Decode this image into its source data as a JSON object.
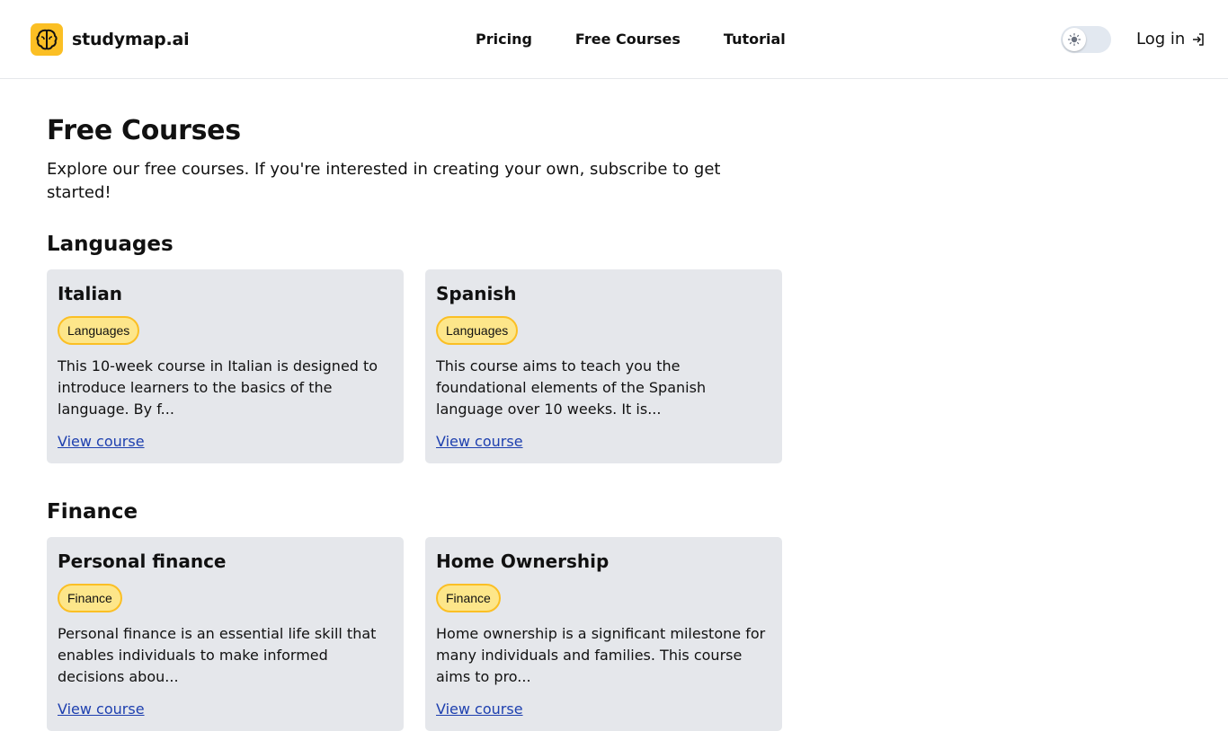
{
  "header": {
    "brand_name": "studymap.ai",
    "logo_icon": "brain-icon",
    "nav": [
      {
        "label": "Pricing"
      },
      {
        "label": "Free Courses"
      },
      {
        "label": "Tutorial"
      }
    ],
    "theme_toggle": {
      "state": "light",
      "icon": "sun-icon"
    },
    "login_label": "Log in",
    "login_icon": "login-icon"
  },
  "main": {
    "title": "Free Courses",
    "description": "Explore our free courses. If you're interested in creating your own, subscribe to get started!",
    "sections": [
      {
        "title": "Languages",
        "courses": [
          {
            "title": "Italian",
            "tag": "Languages",
            "description": "This 10-week course in Italian is designed to introduce learners to the basics of the language. By f...",
            "link_label": "View course"
          },
          {
            "title": "Spanish",
            "tag": "Languages",
            "description": "This course aims to teach you the foundational elements of the Spanish language over 10 weeks. It is...",
            "link_label": "View course"
          }
        ]
      },
      {
        "title": "Finance",
        "courses": [
          {
            "title": "Personal finance",
            "tag": "Finance",
            "description": "Personal finance is an essential life skill that enables individuals to make informed decisions abou...",
            "link_label": "View course"
          },
          {
            "title": "Home Ownership",
            "tag": "Finance",
            "description": "Home ownership is a significant milestone for many individuals and families. This course aims to pro...",
            "link_label": "View course"
          }
        ]
      }
    ]
  },
  "colors": {
    "brand_yellow": "#fbbf24",
    "badge_fill": "#fde68a",
    "card_bg": "#e5e7eb",
    "link": "#1e40af",
    "toggle_track": "#e2e8f0"
  }
}
